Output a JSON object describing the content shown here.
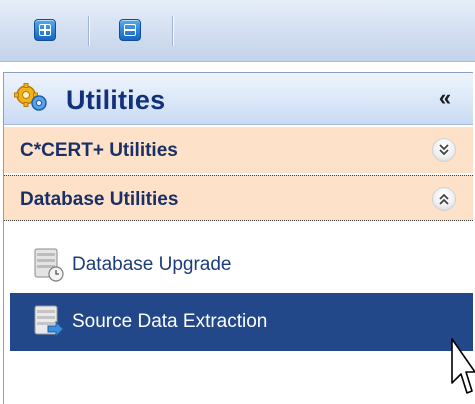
{
  "toolbar": {
    "buttons": [
      {
        "icon": "expand-all-icon"
      },
      {
        "icon": "collapse-all-icon"
      }
    ]
  },
  "panel": {
    "title": "Utilities",
    "collapse_glyph": "«",
    "groups": [
      {
        "label": "C*CERT+ Utilities",
        "state": "collapsed",
        "chevron": "»"
      },
      {
        "label": "Database Utilities",
        "state": "expanded",
        "chevron": "«"
      }
    ],
    "items": [
      {
        "label": "Database Upgrade",
        "icon": "database-upgrade-icon",
        "selected": false
      },
      {
        "label": "Source Data Extraction",
        "icon": "source-data-extraction-icon",
        "selected": true
      }
    ]
  },
  "colors": {
    "toolbar_bg": "#d2def0",
    "group_header_bg": "#fde2c9",
    "selected_bg": "#22488a",
    "title_text": "#13317a"
  }
}
